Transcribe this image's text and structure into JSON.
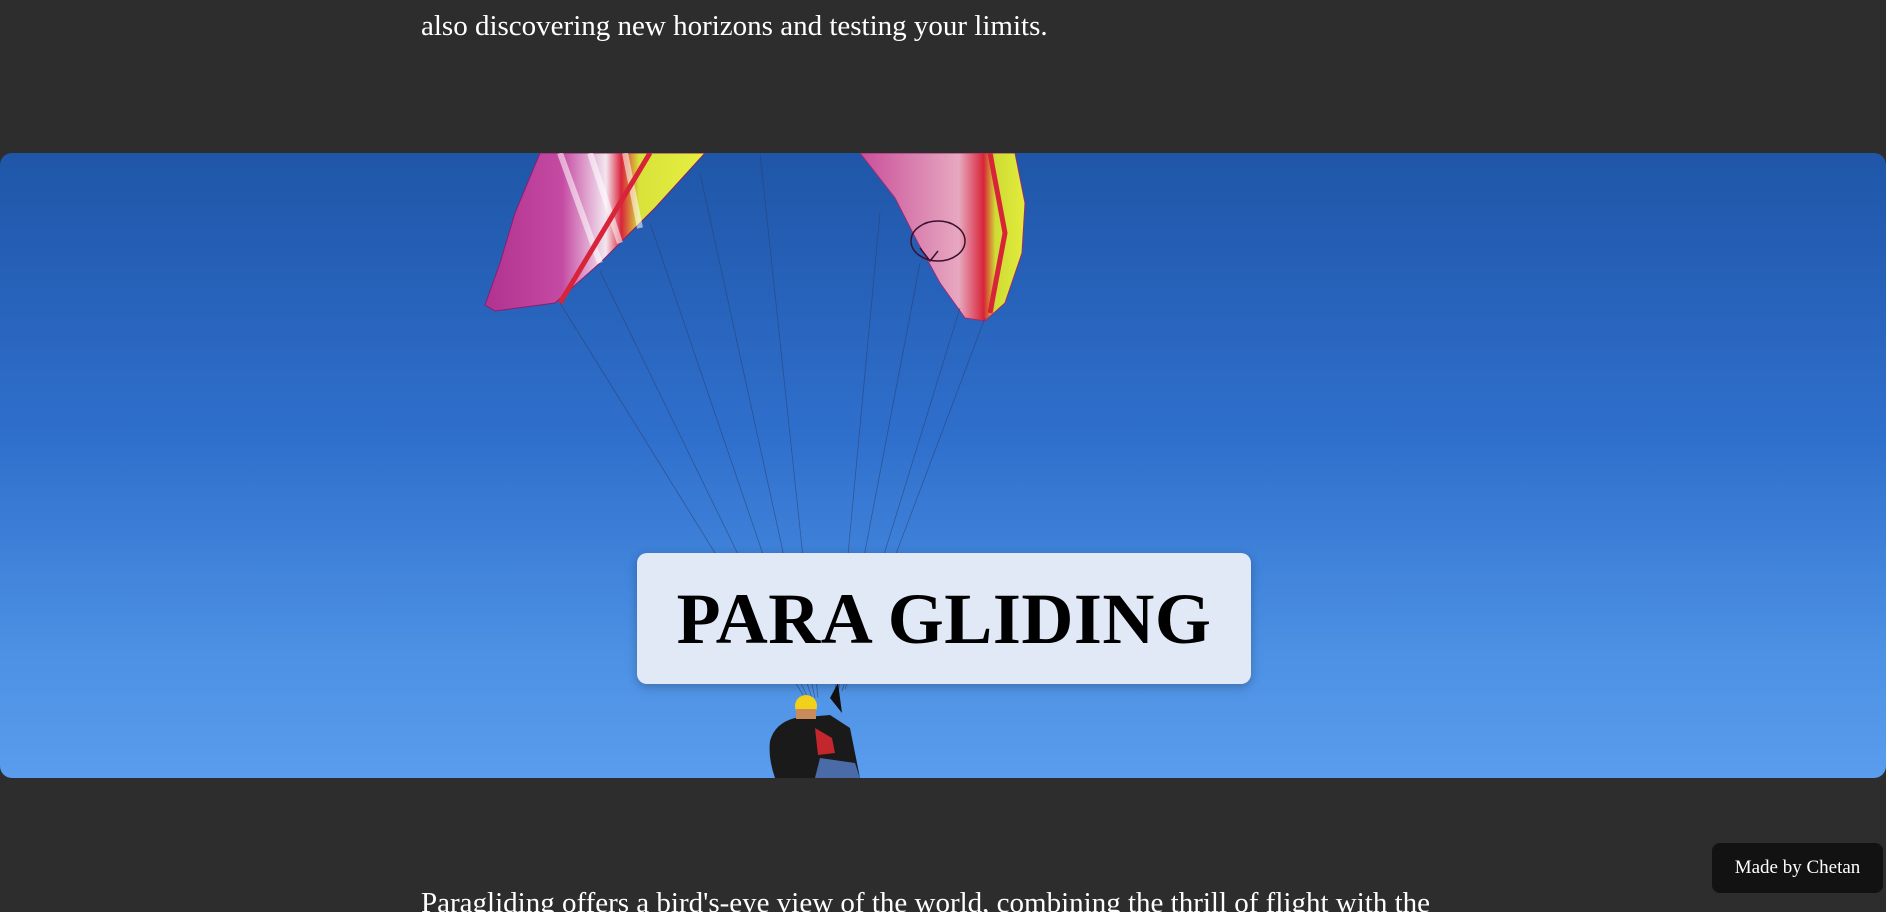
{
  "intro": {
    "text": "also discovering new horizons and testing your limits."
  },
  "hero": {
    "title": "PARA GLIDING",
    "image": "paraglider-over-blue-sky"
  },
  "body": {
    "text": "Paragliding offers a bird's-eye view of the world, combining the thrill of flight with the"
  },
  "footer": {
    "credit": "Made by Chetan"
  },
  "colors": {
    "page_background": "#2d2d2d",
    "title_box": "#e1e9f7",
    "sky_top": "#1f56a8",
    "sky_bottom": "#5a9ced",
    "badge": "#121212"
  }
}
